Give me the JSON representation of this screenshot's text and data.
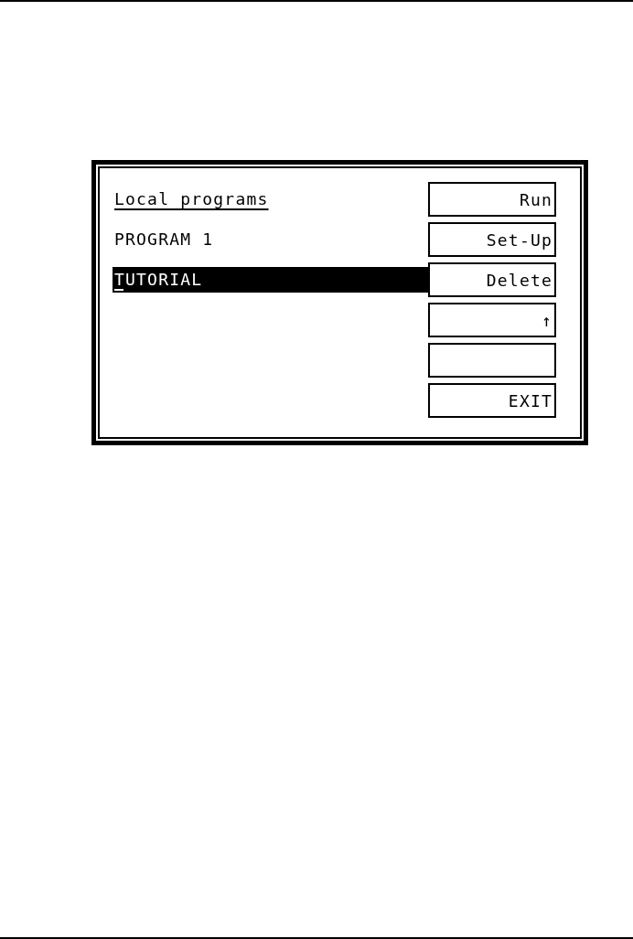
{
  "screen": {
    "heading": "Local programs",
    "programs": [
      {
        "name": "PROGRAM 1",
        "selected": false
      },
      {
        "name": "TUTORIAL",
        "selected": true
      }
    ],
    "softkeys": [
      {
        "kind": "text",
        "label": "Run"
      },
      {
        "kind": "text",
        "label": "Set-Up"
      },
      {
        "kind": "text",
        "label": "Delete"
      },
      {
        "kind": "text",
        "label": "↑"
      },
      {
        "kind": "blank"
      },
      {
        "kind": "text",
        "label": "EXIT"
      }
    ]
  }
}
